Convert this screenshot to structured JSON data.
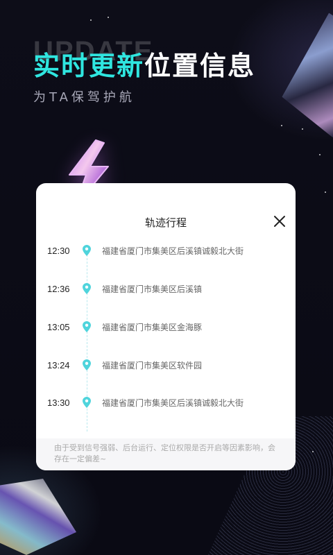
{
  "hero": {
    "bg_word": "UPDATE",
    "headline_accent": "实时更新",
    "headline_rest": "位置信息",
    "subtitle": "为TA保驾护航"
  },
  "card": {
    "title": "轨迹行程",
    "close_icon": "close-icon",
    "pin_icon": "location-pin-icon",
    "entries": [
      {
        "time": "12:30",
        "address": "福建省厦门市集美区后溪镇诚毅北大街"
      },
      {
        "time": "12:36",
        "address": "福建省厦门市集美区后溪镇"
      },
      {
        "time": "13:05",
        "address": "福建省厦门市集美区金海豚"
      },
      {
        "time": "13:24",
        "address": "福建省厦门市集美区软件园"
      },
      {
        "time": "13:30",
        "address": "福建省厦门市集美区后溪镇诚毅北大街"
      }
    ],
    "notice": "由于受到信号强弱、后台运行、定位权限是否开启等因素影响，会存在一定偏差~"
  },
  "colors": {
    "accent": "#2fe6e0",
    "background": "#0b0b14",
    "pin": "#4fd4dc"
  }
}
